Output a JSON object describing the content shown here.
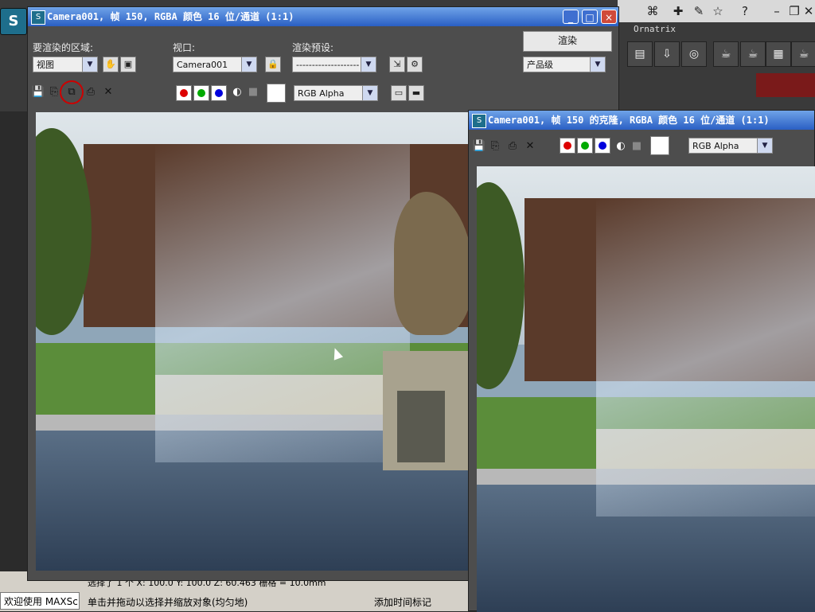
{
  "app": {
    "ornatrix_label": "Ornatrix",
    "welcome_text": "欢迎使用 MAXSc",
    "status_prompt": "单击并拖动以选择并缩放对象(均匀地)",
    "add_time_tag": "添加时间标记",
    "coord_readout": "选择了 1 个  X: 100.0  Y: 100.0  Z: 60.463  栅格 = 10.0mm"
  },
  "win1": {
    "title": "Camera001, 帧 150, RGBA 颜色 16 位/通道 (1:1)",
    "area_label": "要渲染的区域:",
    "area_value": "视图",
    "viewport_label": "视口:",
    "viewport_value": "Camera001",
    "preset_label": "渲染预设:",
    "preset_value": "--------------------",
    "render_button": "渲染",
    "production_value": "产品级",
    "channel_value": "RGB Alpha"
  },
  "win2": {
    "title": "Camera001, 帧 150 的克隆, RGBA 颜色 16 位/通道 (1:1)",
    "channel_value": "RGB Alpha"
  },
  "icons": {
    "close": "×",
    "minimize": "_",
    "maximize": "□"
  }
}
